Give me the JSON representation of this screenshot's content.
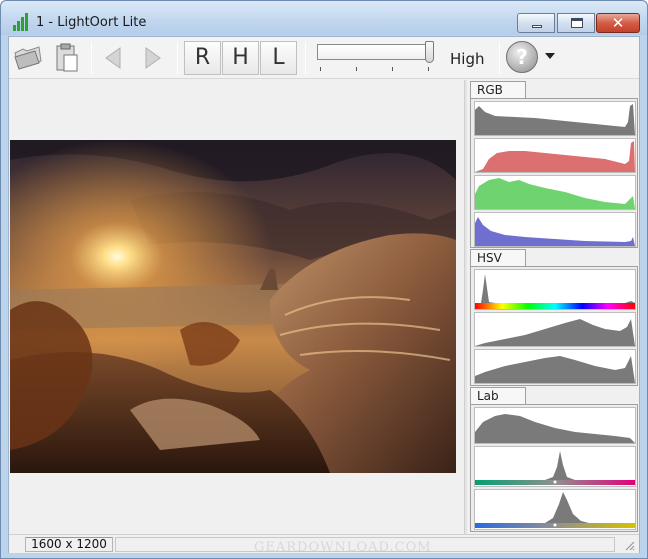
{
  "window": {
    "title": "1 - LightOort Lite",
    "minimize_icon": "minimize-icon",
    "maximize_icon": "maximize-icon",
    "close_icon": "close-icon",
    "close_glyph": "✕"
  },
  "toolbar": {
    "open_icon": "open-folder-icon",
    "paste_icon": "paste-icon",
    "prev_icon": "arrow-left-icon",
    "next_icon": "arrow-right-icon",
    "mode_buttons": [
      {
        "label": "R"
      },
      {
        "label": "H"
      },
      {
        "label": "L"
      }
    ],
    "quality_slider_level": 1.0,
    "quality_label": "High",
    "help_glyph": "?",
    "help_icon": "help-icon",
    "dropdown_icon": "chevron-down-icon"
  },
  "panels": [
    {
      "tab": "RGB",
      "histograms": [
        "luminance",
        "red",
        "green",
        "blue"
      ]
    },
    {
      "tab": "HSV",
      "histograms": [
        "hue",
        "saturation",
        "value"
      ]
    },
    {
      "tab": "Lab",
      "histograms": [
        "lightness",
        "a-channel",
        "b-channel"
      ]
    }
  ],
  "status": {
    "dimensions": "1600 x 1200"
  },
  "watermark": "GEARDOWNLOAD.COM",
  "colors": {
    "hist_gray": "#7a7a7a",
    "hist_red": "#dc6f6f",
    "hist_green": "#6fd46f",
    "hist_blue": "#6f6fd0"
  }
}
